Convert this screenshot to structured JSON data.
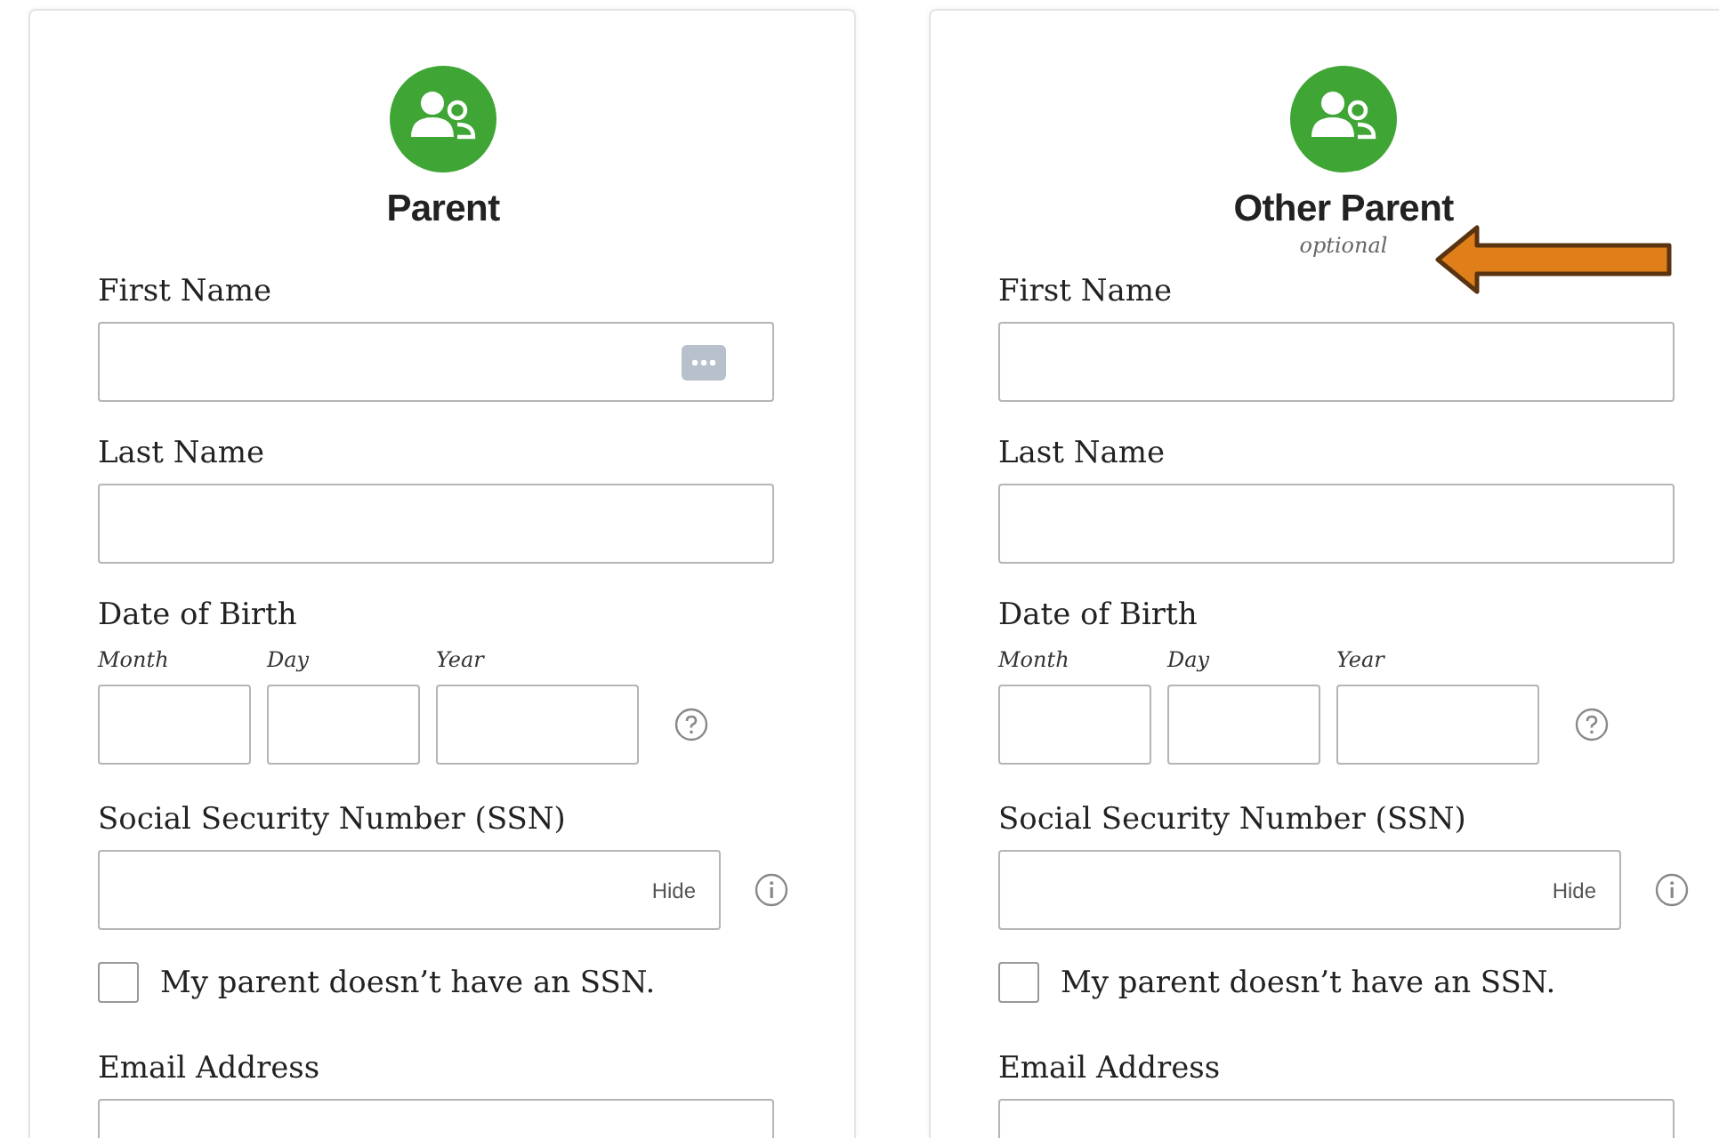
{
  "cards": [
    {
      "title": "Parent",
      "fields": [
        {
          "kind": "text",
          "label": "First Name",
          "autofill": true
        },
        {
          "kind": "text",
          "label": "Last Name"
        },
        {
          "kind": "date",
          "label": "Date of Birth",
          "parts": [
            "Month",
            "Day",
            "Year"
          ]
        },
        {
          "kind": "ssn",
          "label": "Social Security Number (SSN)",
          "toggle": "Hide"
        },
        {
          "kind": "checkbox",
          "label": "My parent doesn’t have an SSN.",
          "checked": false
        },
        {
          "kind": "text",
          "label": "Email Address"
        }
      ]
    },
    {
      "title": "Other Parent",
      "subtitle": "optional",
      "fields": [
        {
          "kind": "text",
          "label": "First Name"
        },
        {
          "kind": "text",
          "label": "Last Name"
        },
        {
          "kind": "date",
          "label": "Date of Birth",
          "parts": [
            "Month",
            "Day",
            "Year"
          ]
        },
        {
          "kind": "ssn",
          "label": "Social Security Number (SSN)",
          "toggle": "Hide"
        },
        {
          "kind": "checkbox",
          "label": "My parent doesn’t have an SSN.",
          "checked": false
        },
        {
          "kind": "text",
          "label": "Email Address"
        }
      ]
    }
  ],
  "annotation": {
    "kind": "arrow",
    "color": "#e07f1a"
  }
}
